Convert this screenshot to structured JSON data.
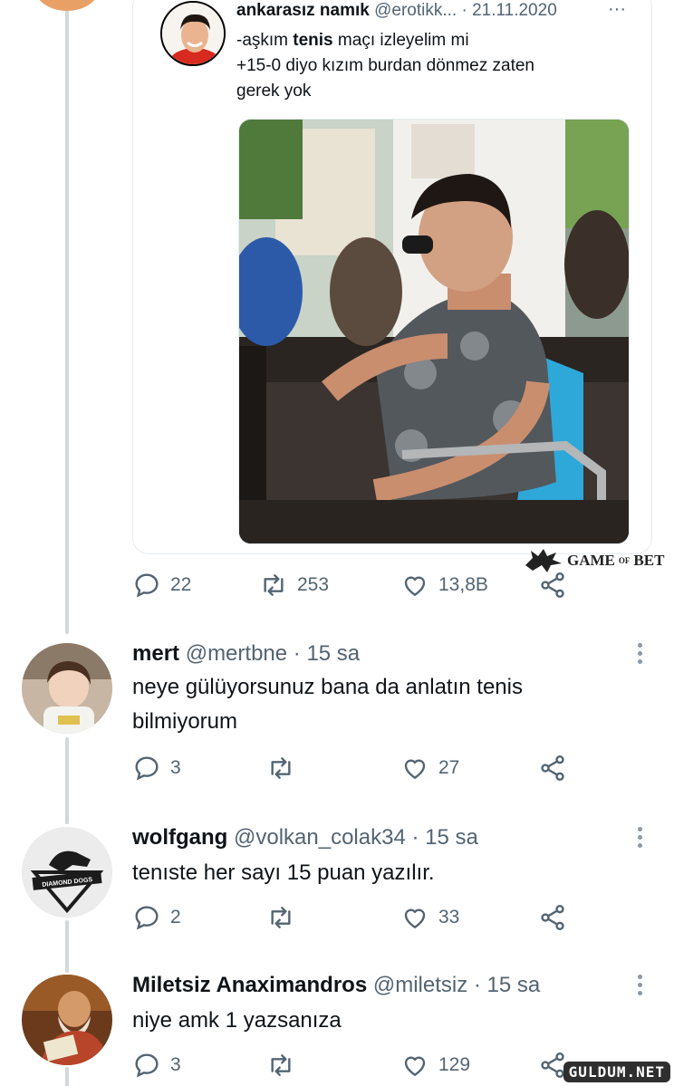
{
  "quoted_tweet": {
    "display_name": "ankarasız namık",
    "handle": "@erotikk...",
    "date_sep": " · ",
    "date": "21.11.2020",
    "more": "···",
    "text_line1_pre": "-aşkım ",
    "text_line1_bold": "tenis",
    "text_line1_post": " maçı izleyelim mi",
    "text_line2": "+15-0 diyo kızım burdan dönmez zaten",
    "text_line3": "gerek yok"
  },
  "watermark": {
    "text_a": "GAME",
    "text_sup": "OF",
    "text_b": "BET"
  },
  "main_actions": {
    "replies": "22",
    "retweets": "253",
    "likes": "13,8B"
  },
  "replies": [
    {
      "display_name": "mert",
      "handle": "@mertbne",
      "time": " · 15 sa",
      "text_line1": "neye gülüyorsunuz bana da anlatın tenis",
      "text_line2": "bilmiyorum",
      "reply_count": "3",
      "retweet_count": "",
      "like_count": "27"
    },
    {
      "display_name": "wolfgang",
      "handle": "@volkan_colak34",
      "time": " · 15 sa",
      "avatar_text": "DIAMOND DOGS",
      "text_line1": "tenıste her sayı 15 puan yazılır.",
      "reply_count": "2",
      "retweet_count": "",
      "like_count": "33"
    },
    {
      "display_name": "Miletsiz Anaximandros",
      "handle": "@miletsiz",
      "time": " · 15 sa",
      "text_line1": "niye amk 1 yazsanıza",
      "reply_count": "3",
      "retweet_count": "",
      "like_count": "129"
    }
  ],
  "site_watermark": "GULDUM.NET",
  "colors": {
    "text": "#0f1419",
    "muted": "#536471",
    "thread_line": "#cfd9de",
    "border": "#e6ecf0"
  },
  "icons": [
    "reply-icon",
    "retweet-icon",
    "like-icon",
    "share-icon",
    "more-icon"
  ]
}
